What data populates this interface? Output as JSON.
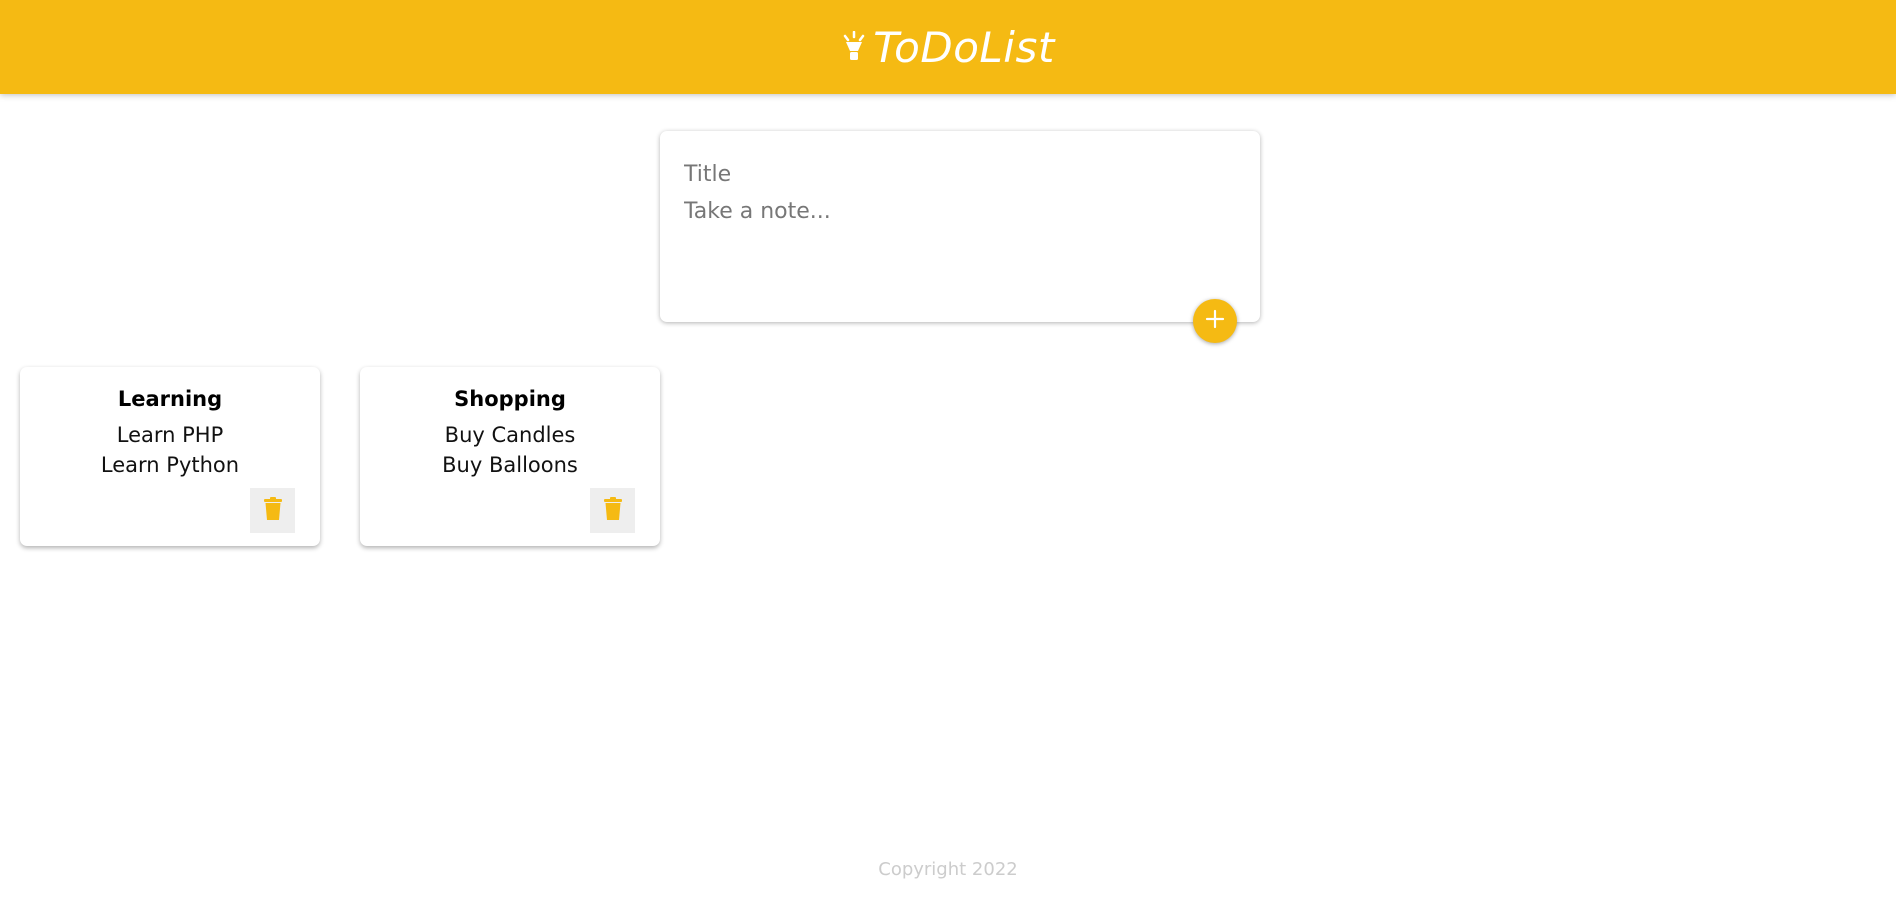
{
  "header": {
    "title": "ToDoList",
    "icon": "lightbulb-icon"
  },
  "composer": {
    "title_placeholder": "Title",
    "note_placeholder": "Take a note...",
    "add_icon": "plus-icon"
  },
  "notes": [
    {
      "title": "Learning",
      "lines": [
        "Learn PHP",
        "Learn Python"
      ],
      "delete_icon": "trash-icon"
    },
    {
      "title": "Shopping",
      "lines": [
        "Buy Candles",
        "Buy Balloons"
      ],
      "delete_icon": "trash-icon"
    }
  ],
  "footer": {
    "text": "Copyright 2022"
  },
  "colors": {
    "brand": "#f5ba13",
    "delete_bg": "#eeeeee"
  }
}
